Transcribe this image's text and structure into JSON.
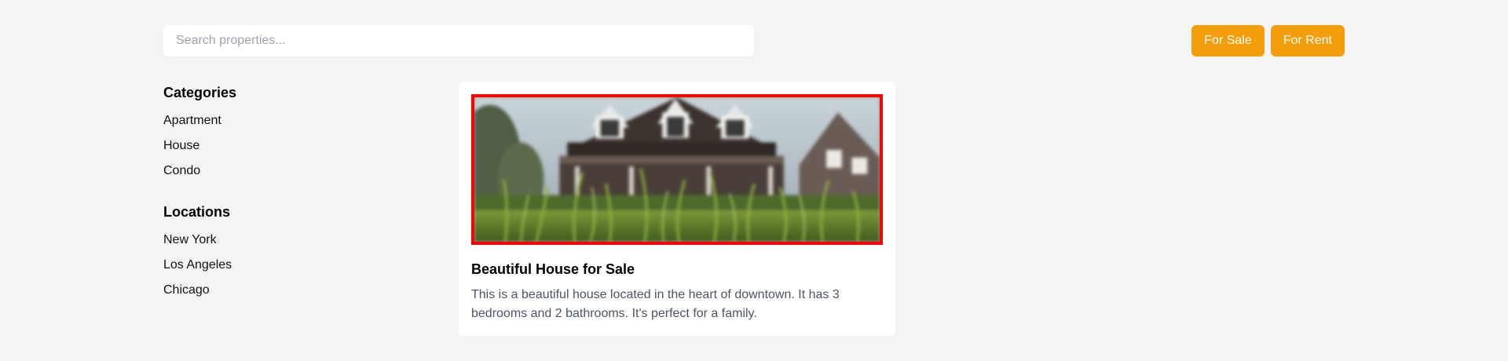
{
  "search": {
    "placeholder": "Search properties..."
  },
  "filters": [
    {
      "label": "For Sale"
    },
    {
      "label": "For Rent"
    }
  ],
  "sidebar": {
    "categories": {
      "heading": "Categories",
      "items": [
        "Apartment",
        "House",
        "Condo"
      ]
    },
    "locations": {
      "heading": "Locations",
      "items": [
        "New York",
        "Los Angeles",
        "Chicago"
      ]
    }
  },
  "listing": {
    "title": "Beautiful House for Sale",
    "description": "This is a beautiful house located in the heart of downtown. It has 3 bedrooms and 2 bathrooms. It's perfect for a family."
  },
  "colors": {
    "background": "#f3f4f6",
    "accent": "#f59e0b",
    "image_border": "#ff0000"
  }
}
